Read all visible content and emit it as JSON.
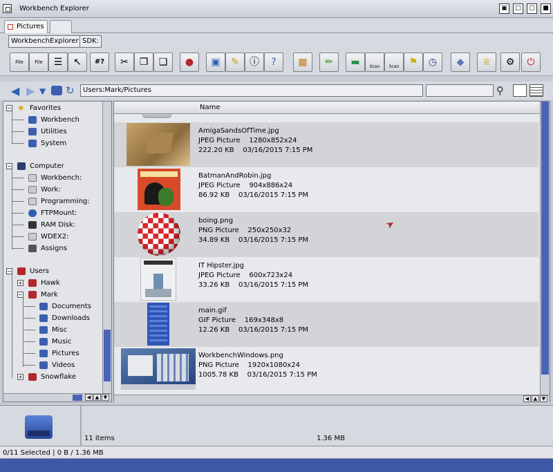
{
  "window": {
    "title": "Workbench Explorer"
  },
  "tabs": [
    {
      "label": "Pictures"
    },
    {
      "label": ""
    }
  ],
  "pathbar": {
    "app_label": "WorkbenchExplorer",
    "sdk_label": "SDK:"
  },
  "toolbar": {
    "icons": [
      "file-view-icon",
      "file-list-icon",
      "compare-icon",
      "select-icon",
      "shell-icon",
      "cut-icon",
      "copy-icon",
      "paste-icon",
      "delete-icon",
      "disk-icon",
      "edit-icon",
      "info-icon",
      "help-icon",
      "archive-icon",
      "pencil-icon",
      "screen-icon",
      "scan-icon",
      "scan2-icon",
      "tag-icon",
      "clock-icon",
      "shield-icon",
      "crown-icon",
      "prefs-icon",
      "power-icon"
    ],
    "tool_text_file1": "File",
    "tool_text_file2": "File",
    "tool_text_shell": "#?",
    "tool_text_scan1": "Scan",
    "tool_text_scan2": "Scan"
  },
  "nav": {
    "path": "Users:Mark/Pictures",
    "search_placeholder": ""
  },
  "sidebar": {
    "favorites": {
      "label": "Favorites",
      "items": [
        "Workbench",
        "Utilities",
        "System"
      ]
    },
    "computer": {
      "label": "Computer",
      "items": [
        "Workbench:",
        "Work:",
        "Programming:",
        "FTPMount:",
        "RAM Disk:",
        "WDEX2:",
        "Assigns"
      ]
    },
    "users": {
      "label": "Users",
      "items": [
        "Hawk",
        "Mark",
        "Snowflake"
      ],
      "mark_children": [
        "Documents",
        "Downloads",
        "Misc",
        "Music",
        "Pictures",
        "Videos"
      ]
    }
  },
  "list": {
    "column_name": "Name",
    "files": [
      {
        "name": "AmigaSandsOfTime.jpg",
        "type": "JPEG Picture",
        "dims": "1280x852x24",
        "size": "222.20 KB",
        "date": "03/16/2015 7:15 PM"
      },
      {
        "name": "BatmanAndRobin.jpg",
        "type": "JPEG Picture",
        "dims": "904x886x24",
        "size": "86.92 KB",
        "date": "03/16/2015 7:15 PM"
      },
      {
        "name": "boing.png",
        "type": "PNG Picture",
        "dims": "250x250x32",
        "size": "34.89 KB",
        "date": "03/16/2015 7:15 PM"
      },
      {
        "name": "IT Hipster.jpg",
        "type": "JPEG Picture",
        "dims": "600x723x24",
        "size": "33.26 KB",
        "date": "03/16/2015 7:15 PM"
      },
      {
        "name": "main.gif",
        "type": "GIF Picture",
        "dims": "169x348x8",
        "size": "12.26 KB",
        "date": "03/16/2015 7:15 PM"
      },
      {
        "name": "WorkbenchWindows.png",
        "type": "PNG Picture",
        "dims": "1920x1080x24",
        "size": "1005.78 KB",
        "date": "03/16/2015 7:15 PM"
      }
    ]
  },
  "status": {
    "items": "11 items",
    "total_size": "1.36 MB",
    "selection": "0/11 Selected | 0 B / 1.36 MB"
  },
  "colors": {
    "accent": "#4a64b8",
    "row_alt": "#d2d4d8"
  }
}
